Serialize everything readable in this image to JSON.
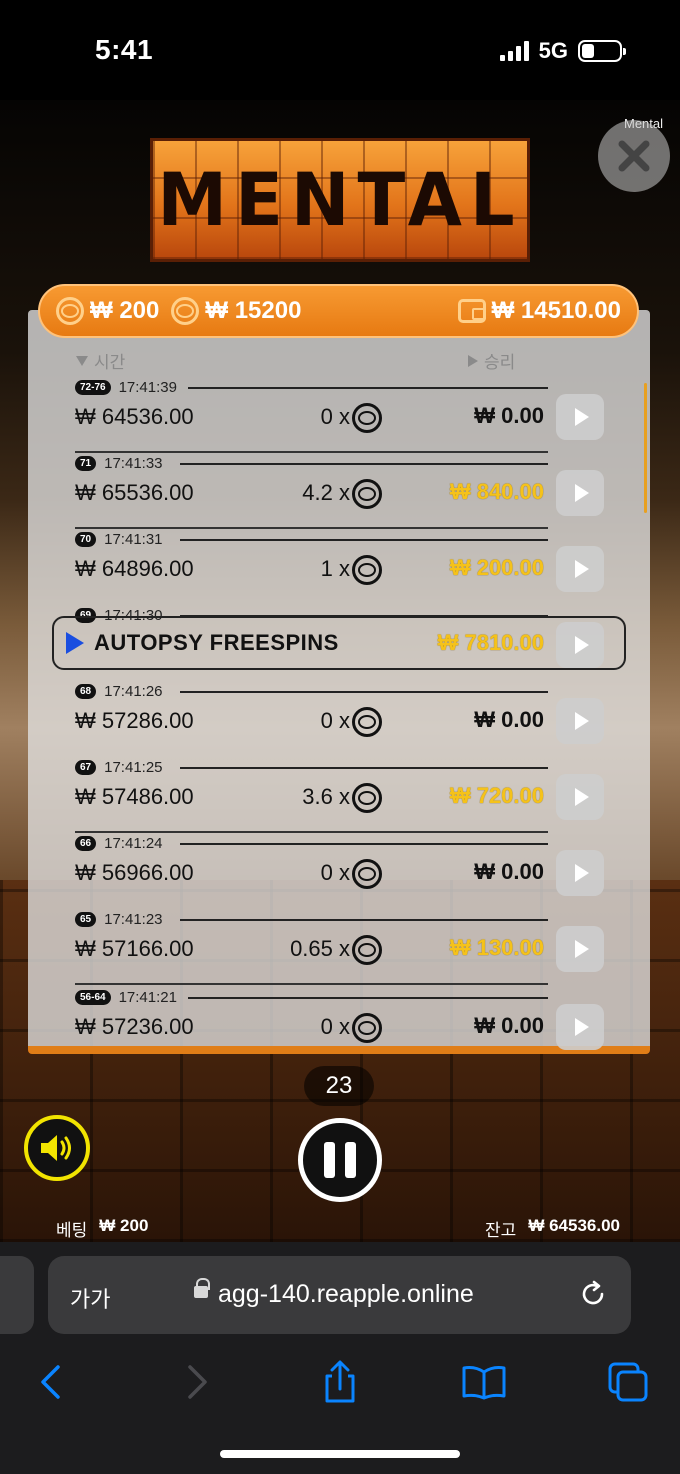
{
  "status_bar": {
    "time": "5:41",
    "network": "5G"
  },
  "game": {
    "logo_text": "MENTAL",
    "close_label": "Mental",
    "top_bar": {
      "bet_value": "₩ 200",
      "total_value": "₩ 15200",
      "win_total": "₩ 14510.00"
    },
    "columns": {
      "time": "시간",
      "win": "승리"
    },
    "rows": [
      {
        "badge": "72-76",
        "time": "17:41:39",
        "amount": "₩ 64536.00",
        "multiplier": "0 x",
        "win": "₩ 0.00",
        "highlight": false
      },
      {
        "badge": "71",
        "time": "17:41:33",
        "amount": "₩ 65536.00",
        "multiplier": "4.2 x",
        "win": "₩ 840.00",
        "highlight": true
      },
      {
        "badge": "70",
        "time": "17:41:31",
        "amount": "₩ 64896.00",
        "multiplier": "1 x",
        "win": "₩ 200.00",
        "highlight": true
      },
      {
        "badge": "69",
        "time": "17:41:30",
        "label": "AUTOPSY FREESPINS",
        "win": "₩ 7810.00",
        "highlight": true
      },
      {
        "badge": "68",
        "time": "17:41:26",
        "amount": "₩ 57286.00",
        "multiplier": "0 x",
        "win": "₩ 0.00",
        "highlight": false
      },
      {
        "badge": "67",
        "time": "17:41:25",
        "amount": "₩ 57486.00",
        "multiplier": "3.6 x",
        "win": "₩ 720.00",
        "highlight": true
      },
      {
        "badge": "66",
        "time": "17:41:24",
        "amount": "₩ 56966.00",
        "multiplier": "0 x",
        "win": "₩ 0.00",
        "highlight": false
      },
      {
        "badge": "65",
        "time": "17:41:23",
        "amount": "₩ 57166.00",
        "multiplier": "0.65 x",
        "win": "₩ 130.00",
        "highlight": true
      },
      {
        "badge": "56-64",
        "time": "17:41:21",
        "amount": "₩ 57236.00",
        "multiplier": "0 x",
        "win": "₩ 0.00",
        "highlight": false
      }
    ],
    "counter": "23",
    "bet_label": "베팅",
    "bet_amount": "₩ 200",
    "balance_label": "잔고",
    "balance_amount": "₩ 64536.00"
  },
  "browser": {
    "text_size_button": "가가",
    "url": "agg-140.reapple.online"
  },
  "icons": [
    "back-icon",
    "forward-icon",
    "share-icon",
    "bookmarks-icon",
    "tabs-icon",
    "reload-icon",
    "lock-icon",
    "sound-icon",
    "pause-icon",
    "close-icon",
    "coin-icon",
    "wallet-icon",
    "play-icon"
  ],
  "colors": {
    "accent_orange": "#e77a12",
    "win_gold": "#f5c21a",
    "sound_ring": "#f2e400",
    "ios_blue": "#0a84ff"
  }
}
